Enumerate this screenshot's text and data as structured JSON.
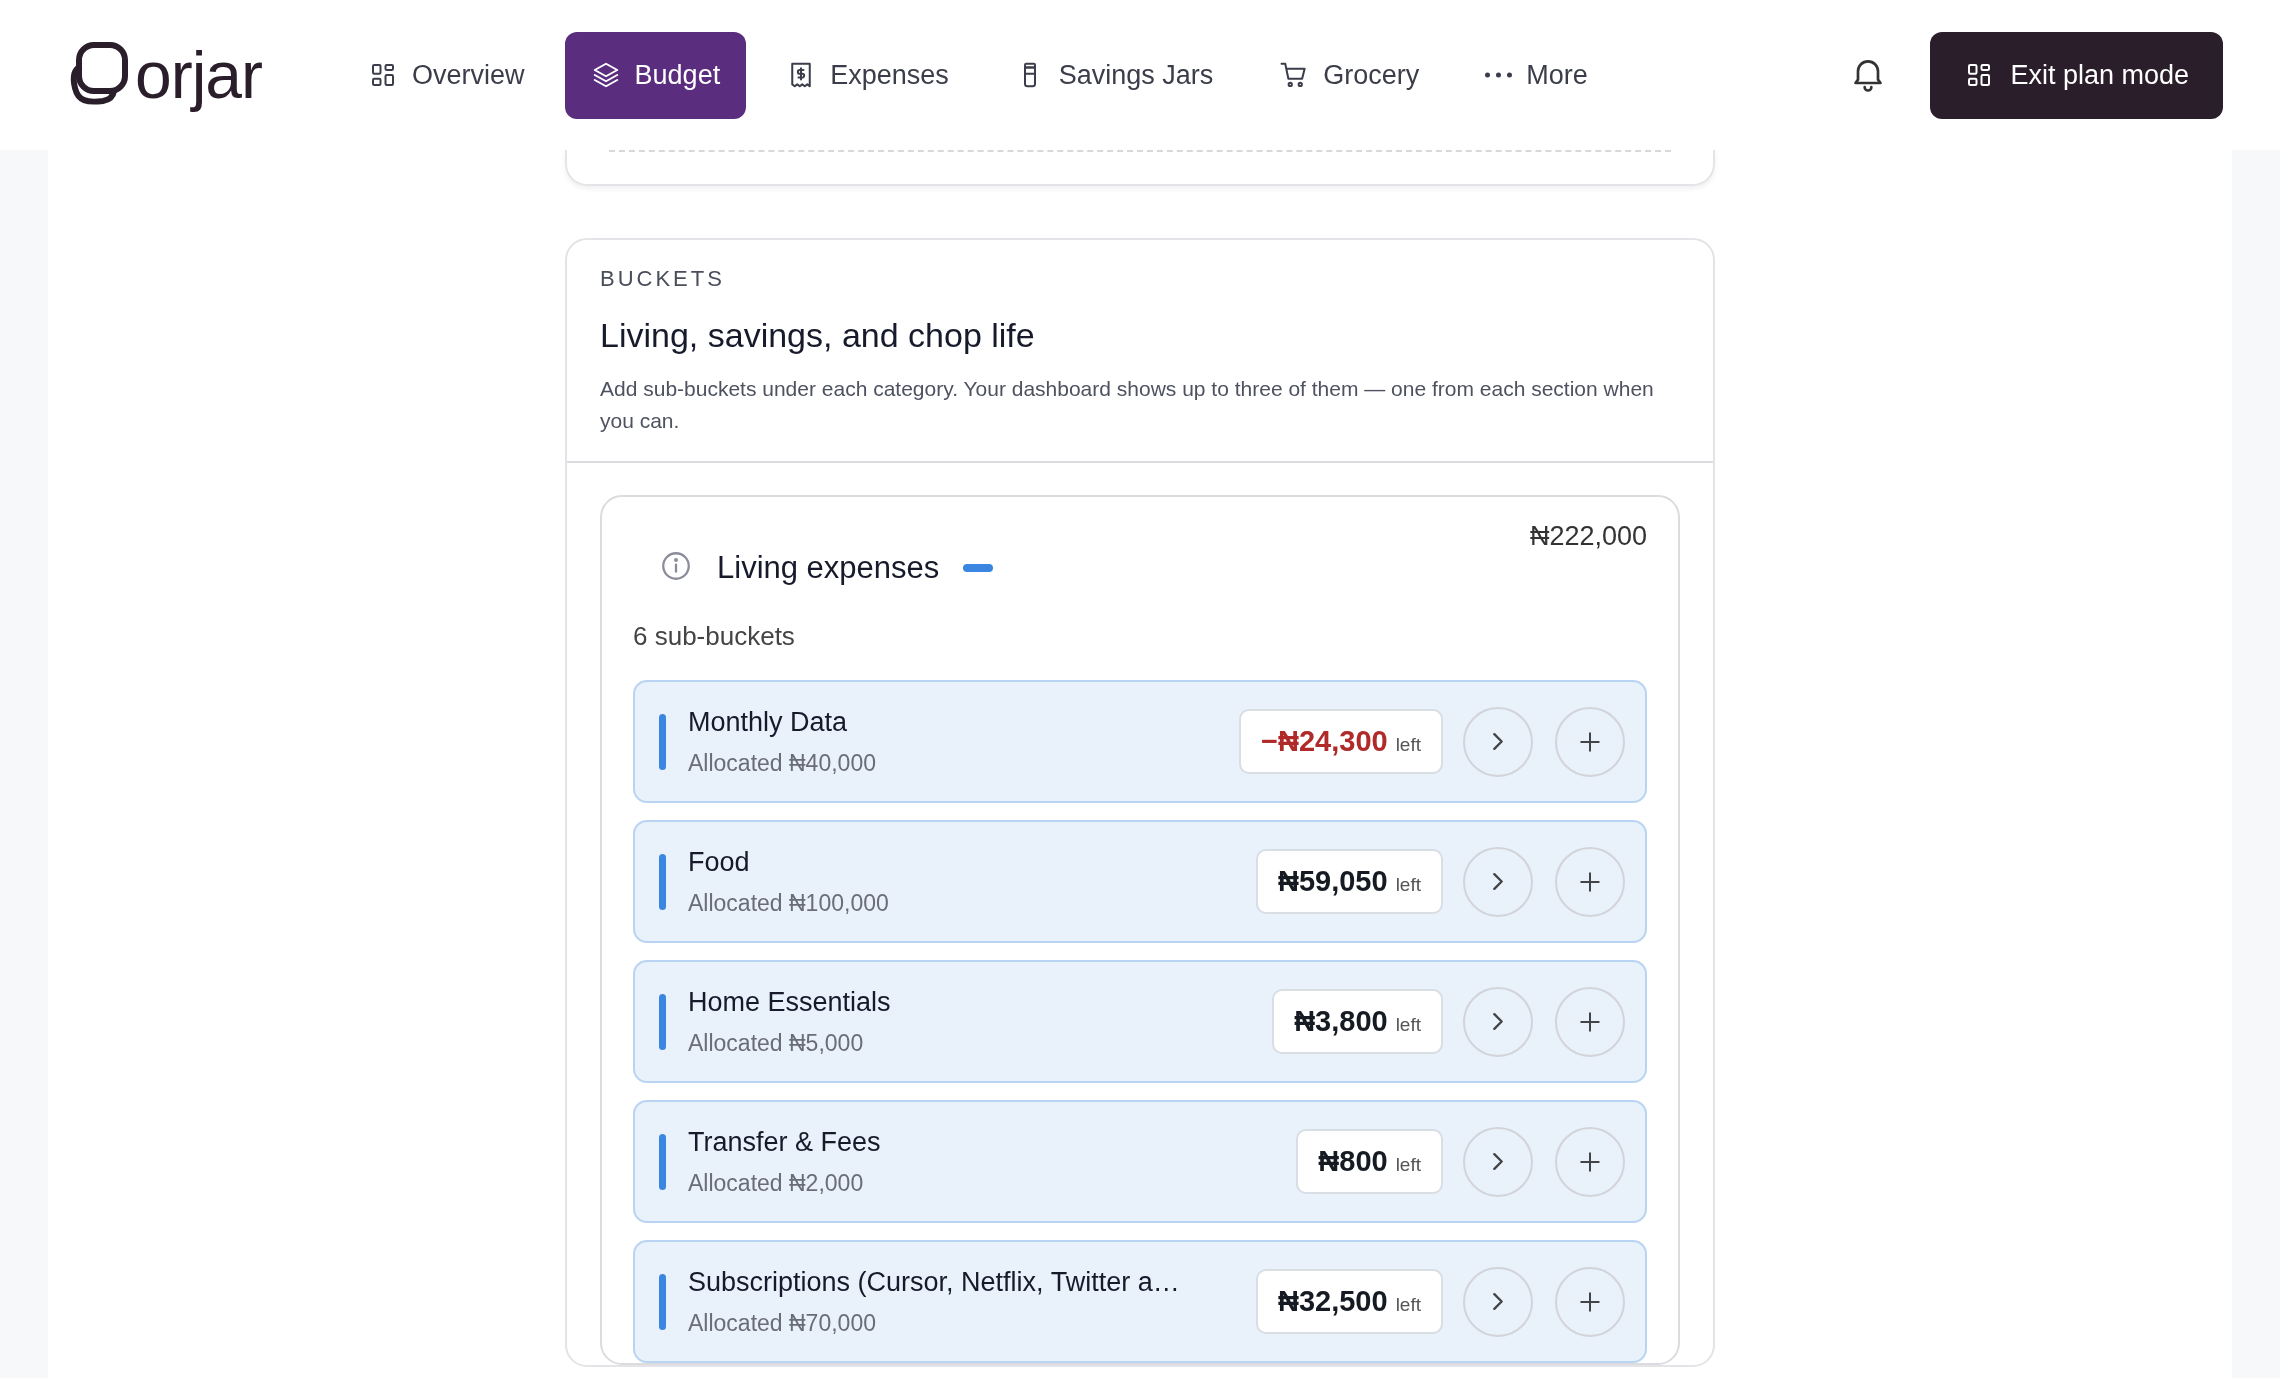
{
  "header": {
    "logo": "orjar",
    "nav": [
      {
        "label": "Overview",
        "selected": false
      },
      {
        "label": "Budget",
        "selected": true
      },
      {
        "label": "Expenses",
        "selected": false
      },
      {
        "label": "Savings Jars",
        "selected": false
      },
      {
        "label": "Grocery",
        "selected": false
      },
      {
        "label": "More",
        "selected": false
      }
    ],
    "exit_button": "Exit plan mode"
  },
  "buckets": {
    "eyebrow": "BUCKETS",
    "title": "Living, savings, and chop life",
    "description": "Add sub-buckets under each category. Your dashboard shows up to three of them — one from each section when you can.",
    "category": {
      "name": "Living expenses",
      "color": "#3a86e0",
      "total": "₦222,000",
      "count": "6 sub-buckets",
      "items": [
        {
          "name": "Monthly Data",
          "allocated": "Allocated ₦40,000",
          "remaining": "−₦24,300",
          "left": "left",
          "overspent": true
        },
        {
          "name": "Food",
          "allocated": "Allocated ₦100,000",
          "remaining": "₦59,050",
          "left": "left",
          "overspent": false
        },
        {
          "name": "Home Essentials",
          "allocated": "Allocated ₦5,000",
          "remaining": "₦3,800",
          "left": "left",
          "overspent": false
        },
        {
          "name": "Transfer & Fees",
          "allocated": "Allocated ₦2,000",
          "remaining": "₦800",
          "left": "left",
          "overspent": false
        },
        {
          "name": "Subscriptions (Cursor, Netflix, Twitter a…",
          "allocated": "Allocated ₦70,000",
          "remaining": "₦32,500",
          "left": "left",
          "overspent": false
        }
      ]
    }
  }
}
